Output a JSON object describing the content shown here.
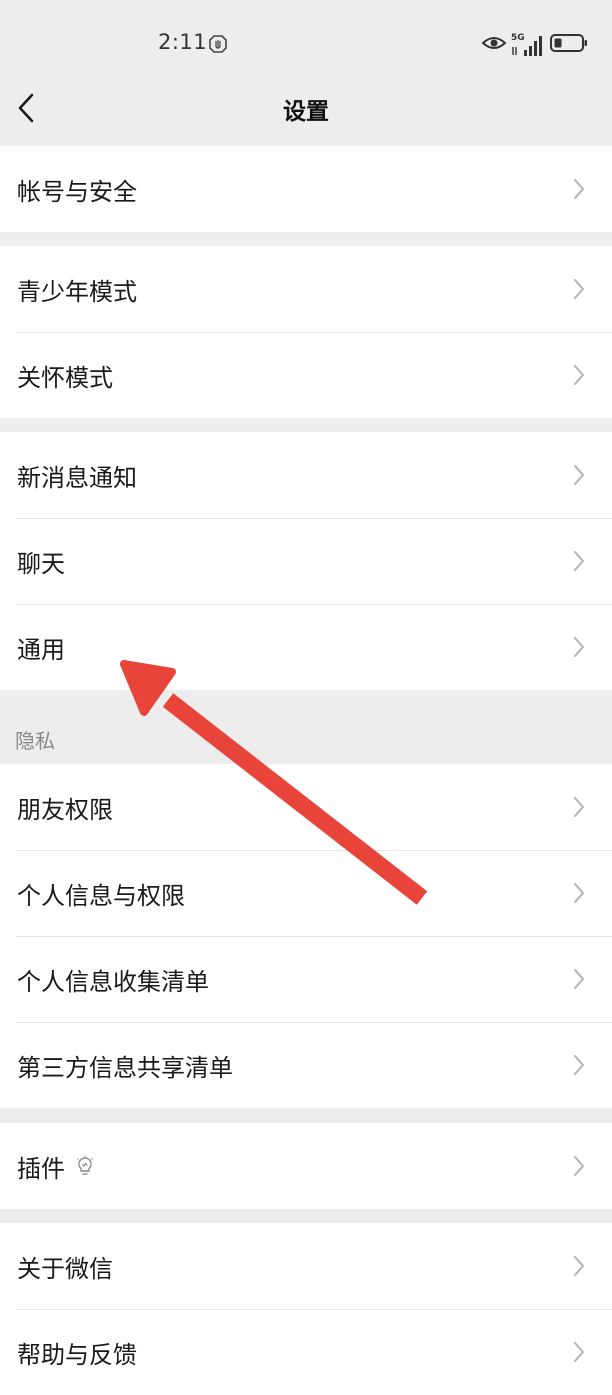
{
  "status_bar": {
    "time": "2:11",
    "network_badge": "5G",
    "icons": [
      "hand-stop-icon",
      "eye-icon",
      "signal-icon",
      "battery-icon"
    ]
  },
  "nav": {
    "title": "设置",
    "back_icon": "chevron-left-icon"
  },
  "groups": [
    {
      "items": [
        {
          "label": "帐号与安全"
        }
      ]
    },
    {
      "items": [
        {
          "label": "青少年模式"
        },
        {
          "label": "关怀模式"
        }
      ]
    },
    {
      "items": [
        {
          "label": "新消息通知"
        },
        {
          "label": "聊天"
        },
        {
          "label": "通用"
        }
      ]
    },
    {
      "header": "隐私",
      "items": [
        {
          "label": "朋友权限"
        },
        {
          "label": "个人信息与权限"
        },
        {
          "label": "个人信息收集清单"
        },
        {
          "label": "第三方信息共享清单"
        }
      ]
    },
    {
      "items": [
        {
          "label": "插件",
          "icon": "bulb-icon"
        }
      ]
    },
    {
      "items": [
        {
          "label": "关于微信"
        },
        {
          "label": "帮助与反馈"
        }
      ]
    }
  ],
  "colors": {
    "background": "#ededed",
    "row_background": "#ffffff",
    "annotation_arrow": "#e8443a",
    "chevron": "#b2b2b2"
  }
}
